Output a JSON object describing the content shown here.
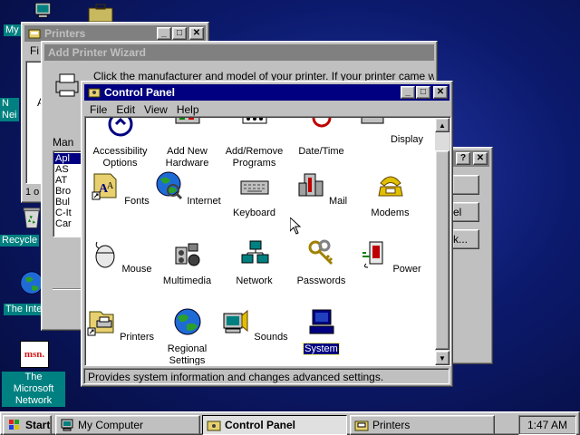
{
  "desktop": {
    "icons": [
      {
        "label": "My"
      },
      {
        "label": "N\nNei"
      },
      {
        "label": "Recycle"
      },
      {
        "label": "The Inte"
      },
      {
        "label": "The Microsoft Network"
      }
    ],
    "msn_logo": "msn."
  },
  "printers_window": {
    "title": "Printers",
    "menu": [
      "Fi"
    ],
    "left_text": "A",
    "status_count": "1 o"
  },
  "wizard_window": {
    "title": "Add Printer Wizard",
    "instruction": "Click the manufacturer and model of your printer. If your printer came with an",
    "manufacturers_label": "Man",
    "manufacturers": [
      "Apl",
      "AS",
      "AT",
      "Bro",
      "Bul",
      "C-It",
      "Car"
    ]
  },
  "back_dialog": {
    "btn2": "el",
    "btn3": "k..."
  },
  "control_panel": {
    "title": "Control Panel",
    "menu": [
      "File",
      "Edit",
      "View",
      "Help"
    ],
    "items": [
      {
        "label": "Accessibility\nOptions",
        "icon": "accessibility-icon"
      },
      {
        "label": "Add New\nHardware",
        "icon": "add-hardware-icon"
      },
      {
        "label": "Add/Remove\nPrograms",
        "icon": "add-remove-programs-icon"
      },
      {
        "label": "Date/Time",
        "icon": "date-time-icon"
      },
      {
        "label": "Display",
        "icon": "display-icon"
      },
      {
        "label": "Fonts",
        "icon": "fonts-icon"
      },
      {
        "label": "Internet",
        "icon": "internet-icon"
      },
      {
        "label": "Keyboard",
        "icon": "keyboard-icon"
      },
      {
        "label": "Mail",
        "icon": "mail-icon"
      },
      {
        "label": "Modems",
        "icon": "modems-icon"
      },
      {
        "label": "Mouse",
        "icon": "mouse-icon"
      },
      {
        "label": "Multimedia",
        "icon": "multimedia-icon"
      },
      {
        "label": "Network",
        "icon": "network-icon"
      },
      {
        "label": "Passwords",
        "icon": "passwords-icon"
      },
      {
        "label": "Power",
        "icon": "power-icon"
      },
      {
        "label": "Printers",
        "icon": "printers-icon"
      },
      {
        "label": "Regional\nSettings",
        "icon": "regional-settings-icon"
      },
      {
        "label": "Sounds",
        "icon": "sounds-icon"
      },
      {
        "label": "System",
        "icon": "system-icon",
        "selected": true
      }
    ],
    "status": "Provides system information and changes advanced settings."
  },
  "taskbar": {
    "start": "Start",
    "tasks": [
      {
        "label": "My Computer",
        "active": false
      },
      {
        "label": "Control Panel",
        "active": true
      },
      {
        "label": "Printers",
        "active": false
      }
    ],
    "clock": "1:47 AM"
  },
  "colors": {
    "title_active": "#000080",
    "title_inactive": "#808080",
    "face": "#c0c0c0",
    "desktop": "#0c1a6e",
    "selection": "#000080"
  }
}
